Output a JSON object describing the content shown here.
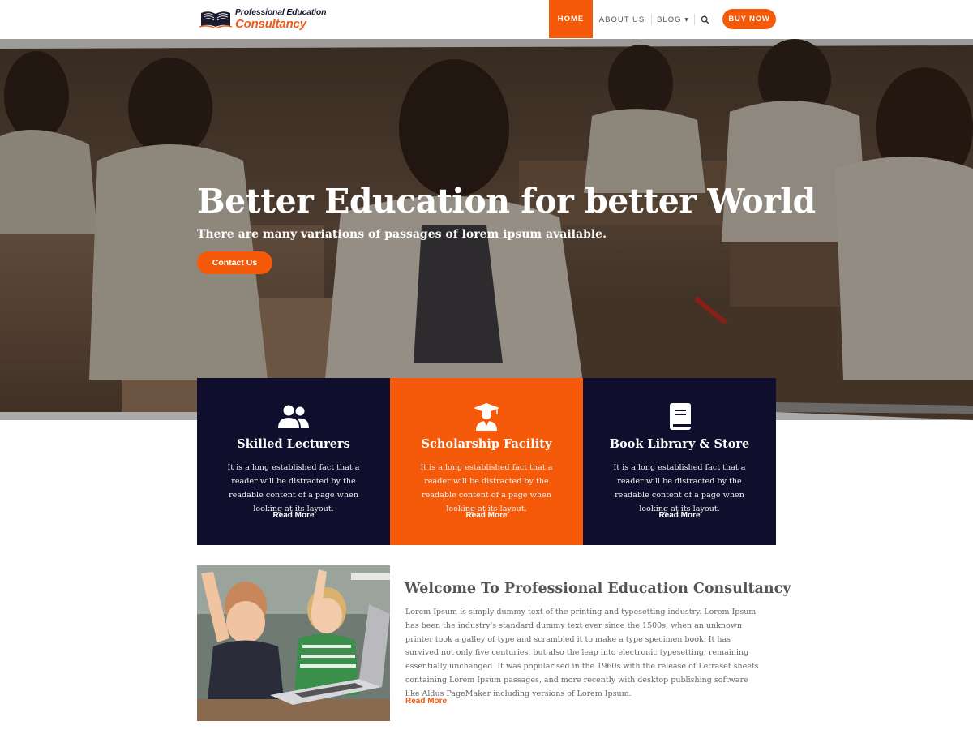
{
  "header": {
    "logo_line1": "Professional Education",
    "logo_line2": "Consultancy",
    "nav": [
      {
        "label": "HOME",
        "active": true
      },
      {
        "label": "ABOUT US"
      },
      {
        "label": "BLOG ▾"
      }
    ],
    "search_icon": "search-icon",
    "buy_label": "BUY NOW"
  },
  "hero": {
    "title": "Better Education for better World",
    "subtitle": "There are many variations of passages of lorem ipsum available.",
    "button": "Contact Us"
  },
  "features": [
    {
      "icon": "users-icon",
      "title": "Skilled Lecturers",
      "text": "It is a long established fact that a reader will be distracted by the readable content of a page when looking at its layout.",
      "link": "Read More"
    },
    {
      "icon": "graduate-icon",
      "title": "Scholarship Facility",
      "text": "It is a long established fact that a reader will be distracted by the readable content of a page when looking at its layout.",
      "link": "Read More"
    },
    {
      "icon": "book-icon",
      "title": "Book Library & Store",
      "text": "It is a long established fact that a reader will be distracted by the readable content of a page when looking at its layout.",
      "link": "Read More"
    }
  ],
  "welcome": {
    "title": "Welcome To Professional Education Consultancy",
    "text": "Lorem Ipsum is simply dummy text of the printing and typesetting industry. Lorem Ipsum has been the industry's standard dummy text ever since the 1500s, when an unknown printer took a galley of type and scrambled it to make a type specimen book. It has survived not only five centuries, but also the leap into electronic typesetting, remaining essentially unchanged. It was popularised in the 1960s with the release of Letraset sheets containing Lorem Ipsum passages, and more recently with desktop publishing software like Aldus PageMaker including versions of Lorem Ipsum.",
    "link": "Read More"
  },
  "colors": {
    "accent": "#f55a0a",
    "navy": "#0f0f2d"
  }
}
